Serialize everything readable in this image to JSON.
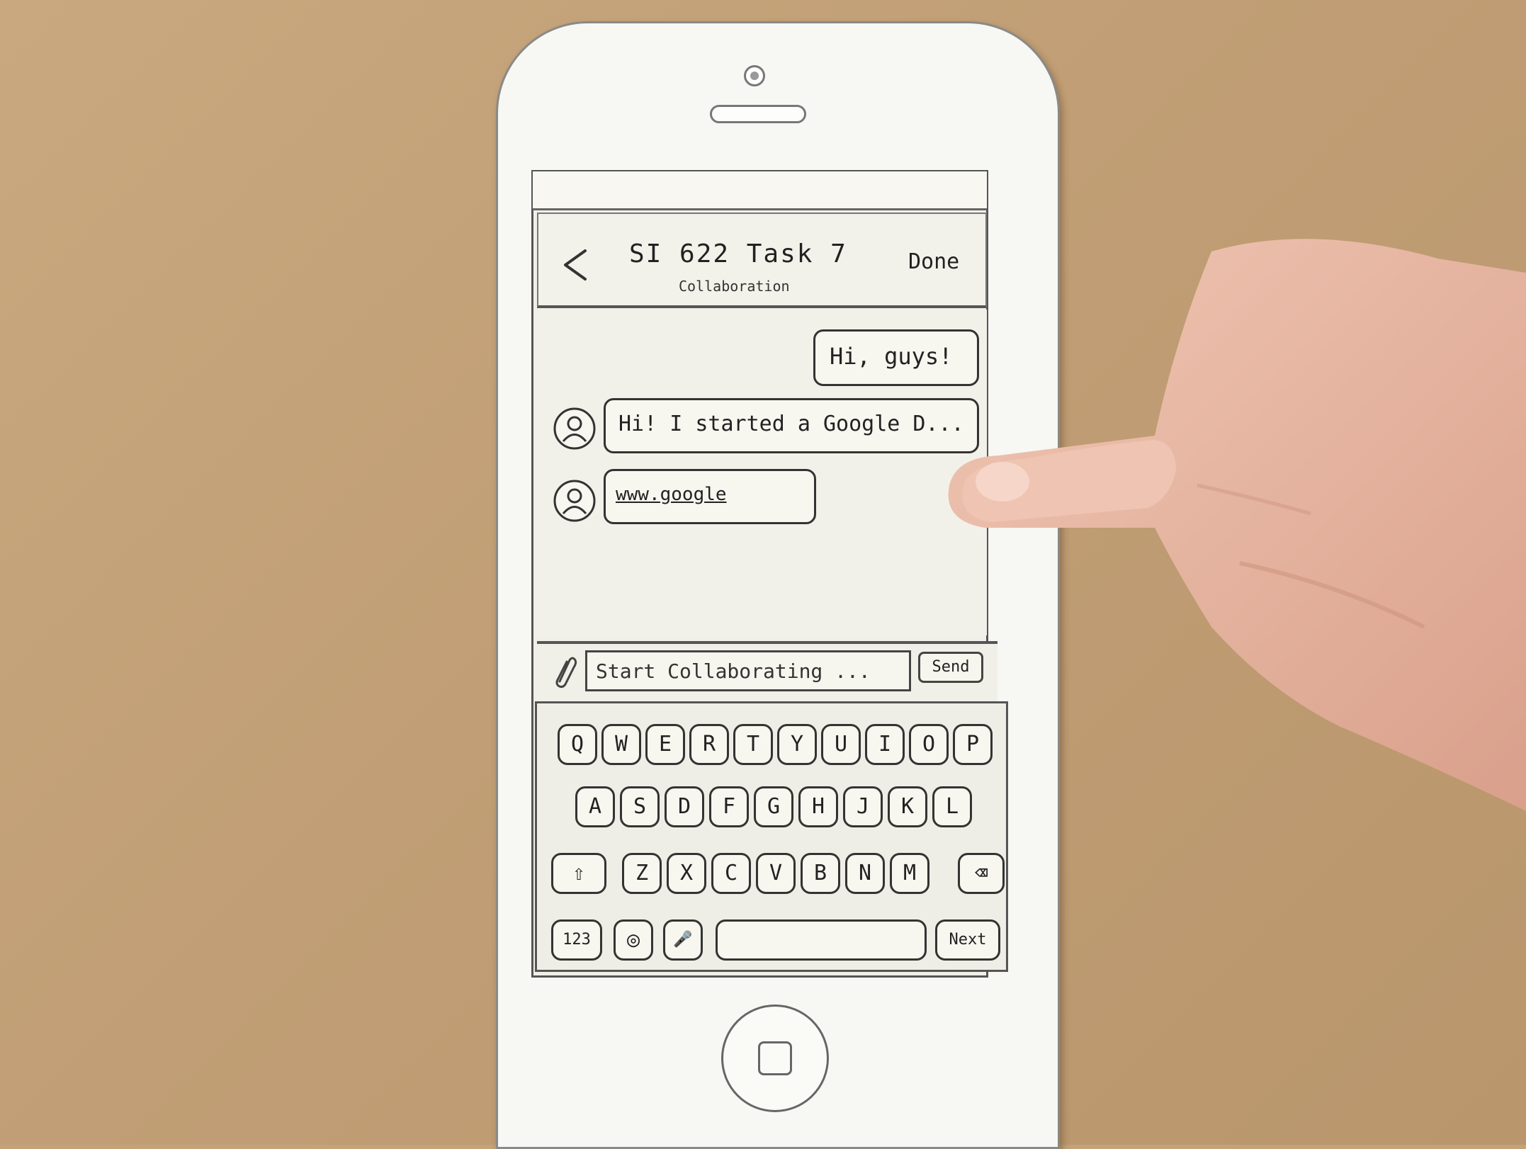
{
  "nav": {
    "title": "SI 622   Task 7",
    "subtitle": "Collaboration",
    "done_label": "Done"
  },
  "messages": {
    "outgoing_1": "Hi, guys!",
    "incoming_1": "Hi! I started a Google D...",
    "incoming_2": "www.google"
  },
  "composer": {
    "placeholder": "Start Collaborating ...",
    "send_label": "Send"
  },
  "keyboard": {
    "row1": [
      "Q",
      "W",
      "E",
      "R",
      "T",
      "Y",
      "U",
      "I",
      "O",
      "P"
    ],
    "row2": [
      "A",
      "S",
      "D",
      "F",
      "G",
      "H",
      "J",
      "K",
      "L"
    ],
    "row3": [
      "Z",
      "X",
      "C",
      "V",
      "B",
      "N",
      "M"
    ],
    "number_key": "123",
    "next_key": "Next"
  },
  "colors": {
    "table": "#c4a27a",
    "paper": "#f7f7f3",
    "ink": "#222222"
  }
}
